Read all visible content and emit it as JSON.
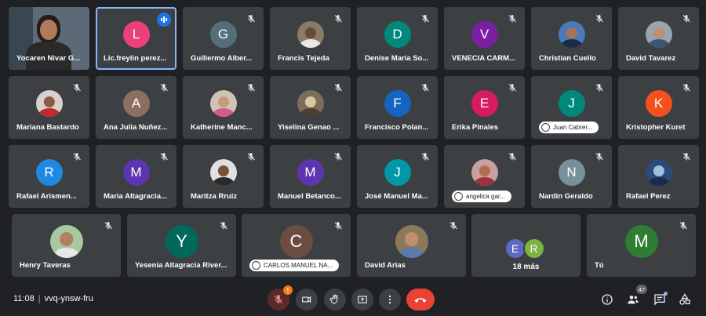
{
  "tiles": [
    {
      "name": "Yocaren Nivar G...",
      "kind": "video",
      "bg": "#5b6a76",
      "skin": "#b07a5c",
      "shirt": "#2a2a2a"
    },
    {
      "name": "Lic.freylin perez...",
      "kind": "letter",
      "letter": "L",
      "color": "#ec407a",
      "speaking": true,
      "active": true
    },
    {
      "name": "Guillermo Alber...",
      "kind": "letter",
      "letter": "G",
      "color": "#546e7a"
    },
    {
      "name": "Francis Tejeda",
      "kind": "photo",
      "bg": "#8a7a68",
      "skin": "#6b4a35",
      "shirt": "#e8e8e8"
    },
    {
      "name": "Denise María So...",
      "kind": "letter",
      "letter": "D",
      "color": "#00897b"
    },
    {
      "name": "VENECIA CARM...",
      "kind": "letter",
      "letter": "V",
      "color": "#7b1fa2"
    },
    {
      "name": "Christian Cuello",
      "kind": "photo",
      "bg": "#4a7ab8",
      "skin": "#a87458",
      "shirt": "#1c2a45"
    },
    {
      "name": "David Tavarez",
      "kind": "photo",
      "bg": "#9aa4ae",
      "skin": "#c09070",
      "shirt": "#3b5576"
    },
    {
      "name": "Mariana Bastardo",
      "kind": "photo",
      "bg": "#d8d0cc",
      "skin": "#8a5a44",
      "shirt": "#c02a2a"
    },
    {
      "name": "Ana Julia Nuñez...",
      "kind": "letter",
      "letter": "A",
      "color": "#8d6e63"
    },
    {
      "name": "Katherine Manc...",
      "kind": "photo",
      "bg": "#cfc3b8",
      "skin": "#c89a78",
      "shirt": "#d05a8a"
    },
    {
      "name": "Yiselina Genao ...",
      "kind": "photo",
      "bg": "#7a6e58",
      "skin": "#d8c8a0",
      "shirt": "#4a4030"
    },
    {
      "name": "Francisco Polan...",
      "kind": "letter",
      "letter": "F",
      "color": "#1565c0"
    },
    {
      "name": "Erika Pinales",
      "kind": "letter",
      "letter": "E",
      "color": "#d81b60"
    },
    {
      "name": "Juan Cabrer...",
      "kind": "letter",
      "letter": "J",
      "color": "#00897b",
      "hand": true
    },
    {
      "name": "Kristopher Kuret",
      "kind": "letter",
      "letter": "K",
      "color": "#f4511e"
    },
    {
      "name": "Rafael Arismen...",
      "kind": "letter",
      "letter": "R",
      "color": "#1e88e5"
    },
    {
      "name": "Maria Altagracia...",
      "kind": "letter",
      "letter": "M",
      "color": "#5e35b1"
    },
    {
      "name": "Maritza Rruiz",
      "kind": "photo",
      "bg": "#e0e0e0",
      "skin": "#7a4e38",
      "shirt": "#2a2a2a"
    },
    {
      "name": "Manuel Betanco...",
      "kind": "letter",
      "letter": "M",
      "color": "#5e35b1"
    },
    {
      "name": "José Manuel Ma...",
      "kind": "letter",
      "letter": "J",
      "color": "#0097a7"
    },
    {
      "name": "angelica gar...",
      "kind": "photo",
      "bg": "#c8a0a0",
      "skin": "#b07050",
      "shirt": "#a03040",
      "hand": true
    },
    {
      "name": "Nardin Geraldo",
      "kind": "letter",
      "letter": "N",
      "color": "#78909c"
    },
    {
      "name": "Rafael Perez",
      "kind": "photo",
      "bg": "#2c4a7a",
      "skin": "#a0c0e0",
      "shirt": "#1a2a4a"
    },
    {
      "name": "Henry Taveras",
      "kind": "photo",
      "bg": "#a8c8a0",
      "skin": "#b08060",
      "shirt": "#e8e8e8"
    },
    {
      "name": "Yesenia Altagracia River...",
      "kind": "letter",
      "letter": "Y",
      "color": "#00695c",
      "big": true
    },
    {
      "name": "CARLOS MANUEL NA...",
      "kind": "letter",
      "letter": "C",
      "color": "#6d4c41",
      "big": true,
      "hand": true
    },
    {
      "name": "David Arias",
      "kind": "photo",
      "bg": "#8a7a5a",
      "skin": "#c09070",
      "shirt": "#5a7ab0"
    },
    {
      "name": "18 más",
      "kind": "more",
      "letters": [
        "E",
        "R"
      ],
      "colors": [
        "#5c6bc0",
        "#7cb342"
      ]
    },
    {
      "name": "Tú",
      "kind": "letter",
      "letter": "M",
      "color": "#2e7d32",
      "big": true
    }
  ],
  "bar": {
    "time": "11:08",
    "meeting_code": "vvq-ynsw-fru",
    "mic_warning": "!",
    "participants_count": "47"
  }
}
